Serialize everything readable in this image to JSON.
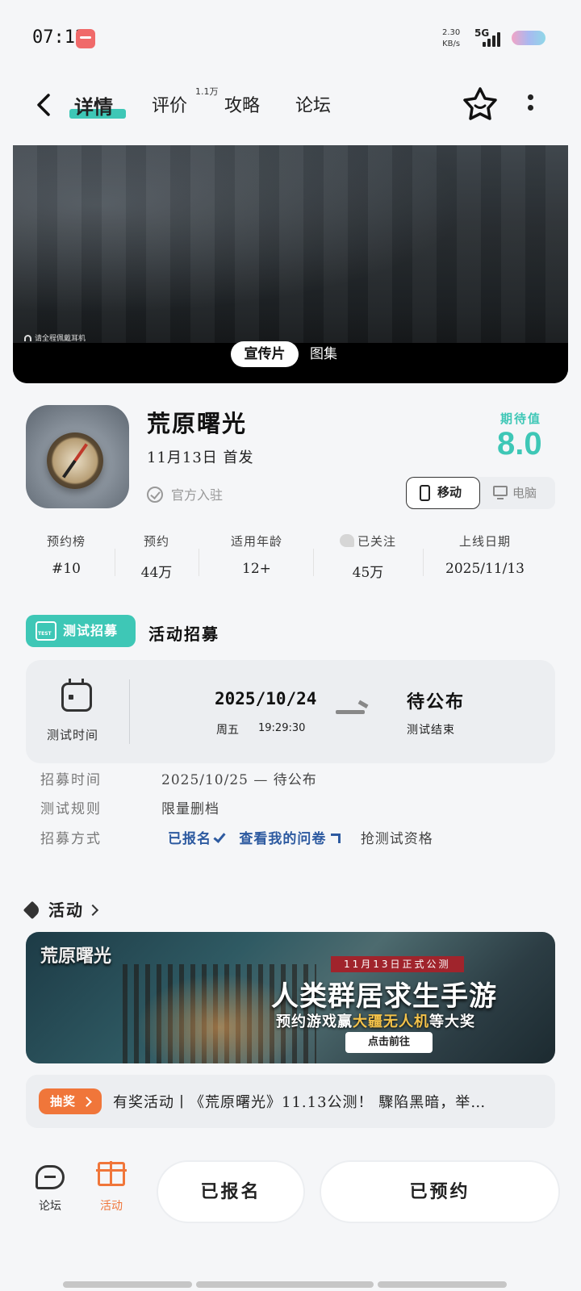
{
  "status_bar": {
    "time": "07:12",
    "net_speed_value": "2.30",
    "net_speed_unit": "KB/s",
    "network": "5G"
  },
  "nav": {
    "tabs": [
      {
        "label": "详情",
        "active": true
      },
      {
        "label": "评价",
        "badge": "1.1万"
      },
      {
        "label": "攻略"
      },
      {
        "label": "论坛"
      }
    ]
  },
  "media": {
    "headphone_note": "请全程佩戴耳机",
    "segments": [
      "宣传片",
      "图集"
    ]
  },
  "game": {
    "title": "荒原曙光",
    "release": "11月13日 首发",
    "official": "官方入驻",
    "expect_label": "期待值",
    "expect_value": "8.0",
    "platforms": [
      "移动",
      "电脑"
    ],
    "accent_color": "#3ec7b6"
  },
  "stats": [
    {
      "label": "预约榜",
      "value": "#10"
    },
    {
      "label": "预约",
      "value": "44万"
    },
    {
      "label": "适用年龄",
      "value": "12+"
    },
    {
      "label": "已关注",
      "value": "45万"
    },
    {
      "label": "上线日期",
      "value": "2025/11/13"
    }
  ],
  "recruit": {
    "badge": "测试招募",
    "title": "活动招募",
    "test_time_label": "测试时间",
    "start_date": "2025/10/24",
    "start_day": "周五",
    "start_clock": "19:29:30",
    "end_status": "待公布",
    "end_label": "测试结束",
    "rows": [
      {
        "label": "招募时间",
        "value": "2025/10/25 — 待公布"
      },
      {
        "label": "测试规则",
        "value": "限量删档"
      },
      {
        "label": "招募方式",
        "signed": "已报名",
        "survey": "查看我的问卷",
        "grab": "抢测试资格"
      }
    ]
  },
  "activity": {
    "heading": "活动",
    "banner": {
      "logo": "荒原曙光",
      "tag": "11月13日正式公测",
      "headline": "人类群居求生手游",
      "sub_pre": "预约游戏赢",
      "sub_highlight": "大疆无人机",
      "sub_post": "等大奖",
      "button": "点击前往"
    },
    "lottery_tag": "抽奖",
    "lottery_text": "有奖活动丨《荒原曙光》11.13公测！ 驟陷黑暗，举…"
  },
  "bottom_bar": {
    "forum": "论坛",
    "activity": "活动",
    "signed_button": "已报名",
    "reserved_button": "已预约",
    "activity_color": "#f0763a"
  }
}
